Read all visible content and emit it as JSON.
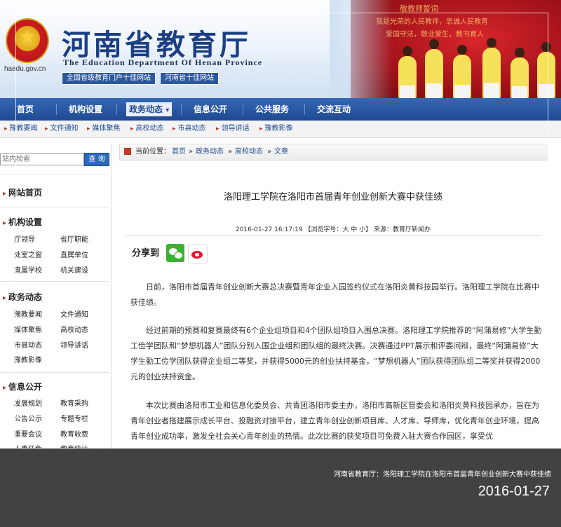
{
  "header": {
    "site_domain": "haedu.gov.cn",
    "title_cn": "河南省教育厅",
    "title_en": "The Education Department Of Henan Province",
    "badges": [
      "全国省级教育门户十佳网站",
      "河南省十佳网站"
    ],
    "banner_text": [
      "敬教师誓词",
      "我是光荣的人民教师，忠诚人民教育",
      "爱国守法，敬业爱生，教书育人"
    ]
  },
  "nav": {
    "items": [
      {
        "label": "首页"
      },
      {
        "label": "机构设置"
      },
      {
        "label": "政务动态",
        "active": true
      },
      {
        "label": "信息公开"
      },
      {
        "label": "公共服务"
      },
      {
        "label": "交流互动"
      }
    ],
    "dropdown_glyph": "▾"
  },
  "subnav": {
    "items": [
      "豫教要闻",
      "文件通知",
      "媒体聚焦",
      "高校动态",
      "市县动态",
      "领导讲话",
      "豫教影像"
    ]
  },
  "sidebar": {
    "search_placeholder": "站内检索",
    "search_button": "查 询",
    "sections": [
      {
        "title": "网站首页",
        "links": []
      },
      {
        "title": "机构设置",
        "links": [
          "厅领导",
          "省厅职能",
          "处室之窗",
          "直属单位",
          "直属学校",
          "机关建设"
        ]
      },
      {
        "title": "政务动态",
        "links": [
          "豫教要闻",
          "文件通知",
          "媒体聚焦",
          "高校动态",
          "市县动态",
          "领导讲话",
          "豫教影像"
        ]
      },
      {
        "title": "信息公开",
        "links": [
          "发展规划",
          "教育采购",
          "公告公示",
          "专题专栏",
          "重要会议",
          "教育收费",
          "人事任免",
          "教育统计"
        ]
      }
    ]
  },
  "breadcrumb": {
    "prefix": "当前位置：",
    "items": [
      "首页",
      "政务动态",
      "高校动态",
      "文章"
    ],
    "separator": "»"
  },
  "article": {
    "title": "洛阳理工学院在洛阳市首届青年创业创新大赛中获佳绩",
    "meta": "2016-01-27 16:17:19 【浏览字号：大 中 小】 来源：教育厅新闻办",
    "share_label": "分享到",
    "paragraphs": [
      "日前，洛阳市首届青年创业创新大赛总决赛暨青年企业入园签约仪式在洛阳炎黄科技园举行。洛阳理工学院在比赛中获佳绩。",
      "经过前期的预赛和复赛最终有6个企业组项目和4个团队组项目入围总决赛。洛阳理工学院推荐的“阿蒲易修”大学生勤工俭学团队和“梦想机器人”团队分别入围企业组和团队组的最终决赛。决赛通过PPT展示和评委问辩，最终“阿蒲易修”大学生勤工俭学团队获得企业组二等奖，并获得5000元的创业扶持基金，“梦想机器人”团队获得团队组二等奖并获得2000元的创业扶持资金。",
      "本次比赛由洛阳市工业和信息化委员会、共青团洛阳市委主办，洛阳市高新区管委会和洛阳炎黄科技园承办，旨在为青年创业者搭建展示成长平台、投融资对接平台，建立青年创业创新项目库、人才库、导师库，优化青年创业环境，提高青年创业成功率，激发全社会关心青年创业的热情。此次比赛的获奖项目可免费入驻大赛合作园区，享受优"
    ]
  },
  "caption": {
    "title": "河南省教育厅：洛阳理工学院在洛阳市首届青年创业创新大赛中获佳绩",
    "date": "2016-01-27"
  }
}
